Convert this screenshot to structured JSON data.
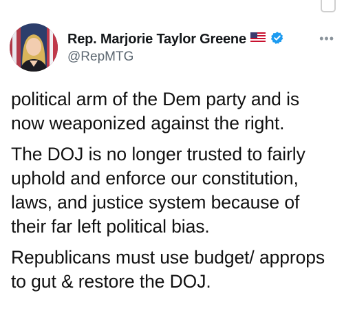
{
  "account": {
    "display_name": "Rep. Marjorie Taylor Greene",
    "handle": "@RepMTG",
    "flag_icon": "us-flag-icon",
    "verified_icon": "verified-badge-icon",
    "verified_color": "#1d9bf0"
  },
  "menu": {
    "more_label": "•••"
  },
  "tweet": {
    "paragraphs": [
      "political arm of the Dem party and is now weaponized against the right.",
      "The DOJ is no longer trusted to fairly uphold and enforce our constitution, laws, and justice system because of their far left political bias.",
      "Republicans must use budget/ approps to gut & restore the DOJ."
    ]
  }
}
